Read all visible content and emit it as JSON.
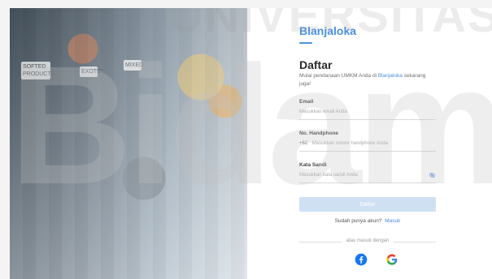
{
  "brand": "Blanjaloka",
  "watermark": {
    "top": "UNIVERSITAS",
    "main": "Bidam"
  },
  "photo": {
    "sign_1": "SOFTED PRODUCTS",
    "sign_2": "EXOTIC",
    "sign_3": "MIXED"
  },
  "form": {
    "title": "Daftar",
    "subtitle_prefix": "Mulai pendanaan UMKM Anda di",
    "subtitle_link": "Blanjaloka",
    "subtitle_suffix": "sekarang juga!",
    "email": {
      "label": "Email",
      "placeholder": "Masukkan email Anda"
    },
    "phone": {
      "label": "No. Handphone",
      "prefix": "+62",
      "placeholder": "Masukkan nomor handphone Anda"
    },
    "password": {
      "label": "Kata Sandi",
      "placeholder": "Masukkan kata sandi Anda"
    },
    "submit_label": "Daftar",
    "have_account": "Sudah punya akun?",
    "login_link": "Masuk",
    "or_login_with": "atau masuk dengan"
  },
  "colors": {
    "accent": "#4a90e2",
    "button_disabled": "#cfe0f3"
  },
  "icons": {
    "password_toggle": "eye-off-icon",
    "social_1": "facebook-icon",
    "social_2": "google-icon"
  }
}
